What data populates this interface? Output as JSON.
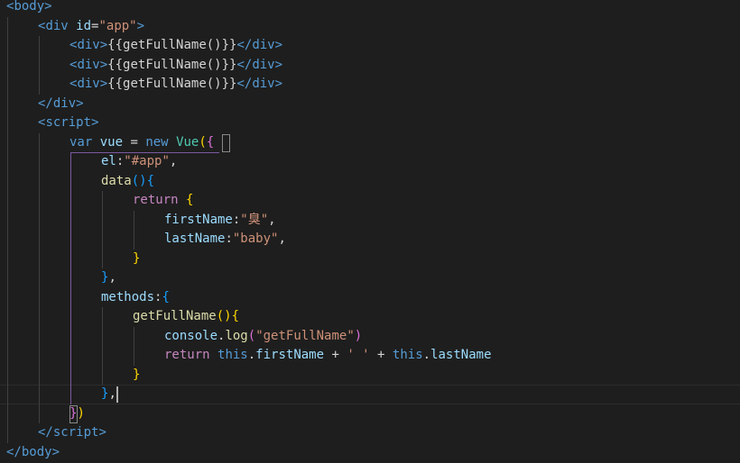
{
  "editor": {
    "language": "html",
    "background": "#1e1e1e",
    "lines": [
      {
        "indent": 0,
        "tokens": [
          [
            "<",
            "tag"
          ],
          [
            "body",
            "tag"
          ],
          [
            ">",
            "tag"
          ]
        ]
      },
      {
        "indent": 1,
        "tokens": [
          [
            "<",
            "tag"
          ],
          [
            "div",
            "tag"
          ],
          [
            " ",
            "txt"
          ],
          [
            "id",
            "attr"
          ],
          [
            "=",
            "txt"
          ],
          [
            "\"app\"",
            "str"
          ],
          [
            ">",
            "tag"
          ]
        ]
      },
      {
        "indent": 2,
        "tokens": [
          [
            "<",
            "tag"
          ],
          [
            "div",
            "tag"
          ],
          [
            ">",
            "tag"
          ],
          [
            "{{getFullName()}}",
            "txt"
          ],
          [
            "</",
            "tag"
          ],
          [
            "div",
            "tag"
          ],
          [
            ">",
            "tag"
          ]
        ]
      },
      {
        "indent": 2,
        "tokens": [
          [
            "<",
            "tag"
          ],
          [
            "div",
            "tag"
          ],
          [
            ">",
            "tag"
          ],
          [
            "{{getFullName()}}",
            "txt"
          ],
          [
            "</",
            "tag"
          ],
          [
            "div",
            "tag"
          ],
          [
            ">",
            "tag"
          ]
        ]
      },
      {
        "indent": 2,
        "tokens": [
          [
            "<",
            "tag"
          ],
          [
            "div",
            "tag"
          ],
          [
            ">",
            "tag"
          ],
          [
            "{{getFullName()}}",
            "txt"
          ],
          [
            "</",
            "tag"
          ],
          [
            "div",
            "tag"
          ],
          [
            ">",
            "tag"
          ]
        ]
      },
      {
        "indent": 1,
        "tokens": [
          [
            "</",
            "tag"
          ],
          [
            "div",
            "tag"
          ],
          [
            ">",
            "tag"
          ]
        ]
      },
      {
        "indent": 1,
        "tokens": [
          [
            "<",
            "tag"
          ],
          [
            "script",
            "tag"
          ],
          [
            ">",
            "tag"
          ]
        ]
      },
      {
        "indent": 2,
        "tokens": [
          [
            "var",
            "kw"
          ],
          [
            " ",
            "txt"
          ],
          [
            "vue",
            "var"
          ],
          [
            " = ",
            "txt"
          ],
          [
            "new",
            "kw"
          ],
          [
            " ",
            "txt"
          ],
          [
            "Vue",
            "cls"
          ],
          [
            "(",
            "br1"
          ],
          [
            "{",
            "br2"
          ]
        ]
      },
      {
        "indent": 3,
        "tokens": [
          [
            "el",
            "var"
          ],
          [
            ":",
            "txt"
          ],
          [
            "\"#app\"",
            "str"
          ],
          [
            ",",
            "txt"
          ]
        ]
      },
      {
        "indent": 3,
        "tokens": [
          [
            "data",
            "fn"
          ],
          [
            "()",
            "br3"
          ],
          [
            "{",
            "br3"
          ]
        ]
      },
      {
        "indent": 4,
        "tokens": [
          [
            "return",
            "ctrl"
          ],
          [
            " ",
            "txt"
          ],
          [
            "{",
            "br1"
          ]
        ]
      },
      {
        "indent": 5,
        "tokens": [
          [
            "firstName",
            "var"
          ],
          [
            ":",
            "txt"
          ],
          [
            "\"臭\"",
            "str"
          ],
          [
            ",",
            "txt"
          ]
        ]
      },
      {
        "indent": 5,
        "tokens": [
          [
            "lastName",
            "var"
          ],
          [
            ":",
            "txt"
          ],
          [
            "\"baby\"",
            "str"
          ],
          [
            ",",
            "txt"
          ]
        ]
      },
      {
        "indent": 4,
        "tokens": [
          [
            "}",
            "br1"
          ]
        ]
      },
      {
        "indent": 3,
        "tokens": [
          [
            "}",
            "br3"
          ],
          [
            ",",
            "txt"
          ]
        ]
      },
      {
        "indent": 3,
        "tokens": [
          [
            "methods",
            "var"
          ],
          [
            ":",
            "txt"
          ],
          [
            "{",
            "br3"
          ]
        ]
      },
      {
        "indent": 4,
        "tokens": [
          [
            "getFullName",
            "fn"
          ],
          [
            "()",
            "br1"
          ],
          [
            "{",
            "br1"
          ]
        ]
      },
      {
        "indent": 5,
        "tokens": [
          [
            "console",
            "var"
          ],
          [
            ".",
            "txt"
          ],
          [
            "log",
            "fn"
          ],
          [
            "(",
            "br2"
          ],
          [
            "\"getFullName\"",
            "str"
          ],
          [
            ")",
            "br2"
          ]
        ]
      },
      {
        "indent": 5,
        "tokens": [
          [
            "return",
            "ctrl"
          ],
          [
            " ",
            "txt"
          ],
          [
            "this",
            "kw"
          ],
          [
            ".",
            "txt"
          ],
          [
            "firstName",
            "var"
          ],
          [
            " + ",
            "txt"
          ],
          [
            "' '",
            "str"
          ],
          [
            " + ",
            "txt"
          ],
          [
            "this",
            "kw"
          ],
          [
            ".",
            "txt"
          ],
          [
            "lastName",
            "var"
          ]
        ]
      },
      {
        "indent": 4,
        "tokens": [
          [
            "}",
            "br1"
          ]
        ]
      },
      {
        "indent": 3,
        "tokens": [
          [
            "}",
            "br3"
          ],
          [
            ",",
            "txt"
          ]
        ]
      },
      {
        "indent": 2,
        "tokens": [
          [
            "}",
            "br2"
          ],
          [
            ")",
            "br1"
          ]
        ]
      },
      {
        "indent": 1,
        "tokens": [
          [
            "</",
            "tag"
          ],
          [
            "script",
            "tag"
          ],
          [
            ">",
            "tag"
          ]
        ]
      },
      {
        "indent": 0,
        "tokens": [
          [
            "</",
            "tag"
          ],
          [
            "body",
            "tag"
          ],
          [
            ">",
            "tag"
          ]
        ]
      }
    ]
  }
}
